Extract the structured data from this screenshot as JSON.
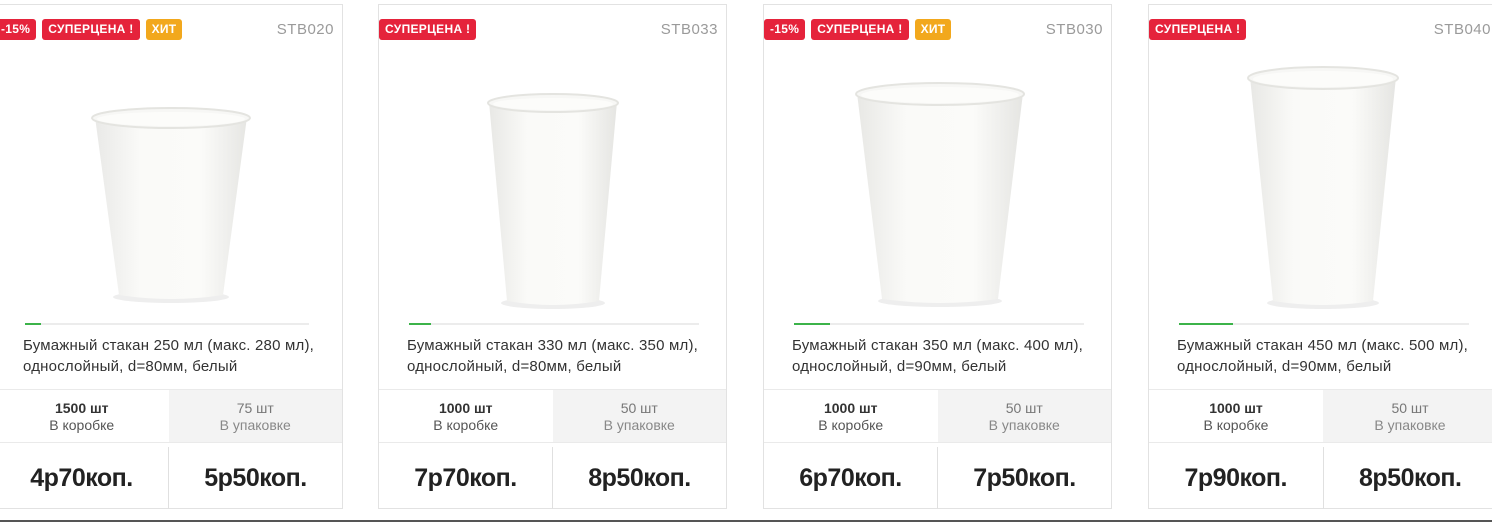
{
  "products": [
    {
      "badges": [
        {
          "text": "-15%",
          "color": "#e5233b"
        },
        {
          "text": "СУПЕРЦЕНА !",
          "color": "#e5233b"
        },
        {
          "text": "ХИТ",
          "color": "#f2a81d"
        }
      ],
      "sku": "STB020",
      "title": "Бумажный стакан 250 мл (макс. 280 мл), однослойный, d=80мм, белый",
      "box_qty": "1500 шт",
      "box_label": "В коробке",
      "pack_qty": "75 шт",
      "pack_label": "В упаковке",
      "price_box": "4р70коп.",
      "price_pack": "5р50коп.",
      "image_icon": "paper-cup-image"
    },
    {
      "badges": [
        {
          "text": "СУПЕРЦЕНА !",
          "color": "#e5233b"
        }
      ],
      "sku": "STB033",
      "title": "Бумажный стакан 330 мл (макс. 350 мл), однослойный, d=80мм, белый",
      "box_qty": "1000 шт",
      "box_label": "В коробке",
      "pack_qty": "50 шт",
      "pack_label": "В упаковке",
      "price_box": "7р70коп.",
      "price_pack": "8р50коп.",
      "image_icon": "paper-cup-image"
    },
    {
      "badges": [
        {
          "text": "-15%",
          "color": "#e5233b"
        },
        {
          "text": "СУПЕРЦЕНА !",
          "color": "#e5233b"
        },
        {
          "text": "ХИТ",
          "color": "#f2a81d"
        }
      ],
      "sku": "STB030",
      "title": "Бумажный стакан 350 мл (макс. 400 мл), однослойный, d=90мм, белый",
      "box_qty": "1000 шт",
      "box_label": "В коробке",
      "pack_qty": "50 шт",
      "pack_label": "В упаковке",
      "price_box": "6р70коп.",
      "price_pack": "7р50коп.",
      "image_icon": "paper-cup-image"
    },
    {
      "badges": [
        {
          "text": "СУПЕРЦЕНА !",
          "color": "#e5233b"
        }
      ],
      "sku": "STB040",
      "title": "Бумажный стакан 450 мл (макс. 500 мл), однослойный, d=90мм, белый",
      "box_qty": "1000 шт",
      "box_label": "В коробке",
      "pack_qty": "50 шт",
      "pack_label": "В упаковке",
      "price_box": "7р90коп.",
      "price_pack": "8р50коп.",
      "image_icon": "paper-cup-image"
    }
  ],
  "colors": {
    "badge_red": "#e5233b",
    "badge_yellow": "#f2a81d",
    "slider_active": "#3cb34a"
  }
}
